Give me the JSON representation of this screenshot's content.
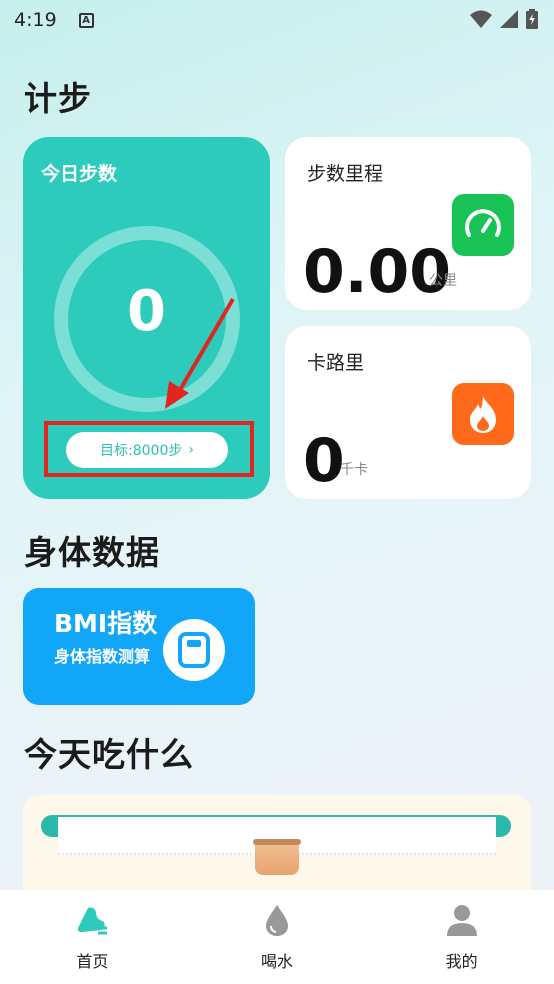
{
  "status": {
    "time": "4:19",
    "notification_glyph": "A"
  },
  "sections": {
    "steps": "计步",
    "body_data": "身体数据",
    "food": "今天吃什么"
  },
  "steps_card": {
    "title": "今日步数",
    "value": "0",
    "goal_label": "目标:8000步"
  },
  "distance_card": {
    "title": "步数里程",
    "value": "0.00",
    "unit": "公里",
    "icon": "speedometer-icon",
    "color": "#18c254"
  },
  "calorie_card": {
    "title": "卡路里",
    "value": "0",
    "unit": "千卡",
    "icon": "flame-icon",
    "color": "#ff6a1a"
  },
  "bmi_card": {
    "title": "BMI指数",
    "subtitle": "身体指数测算",
    "icon": "scale-icon",
    "color": "#11a6f7"
  },
  "nav": [
    {
      "label": "首页",
      "icon": "shoe-icon",
      "active": true
    },
    {
      "label": "喝水",
      "icon": "water-drop-icon",
      "active": false
    },
    {
      "label": "我的",
      "icon": "user-icon",
      "active": false
    }
  ],
  "colors": {
    "accent": "#2dcbbb",
    "highlight": "#e0261f"
  }
}
